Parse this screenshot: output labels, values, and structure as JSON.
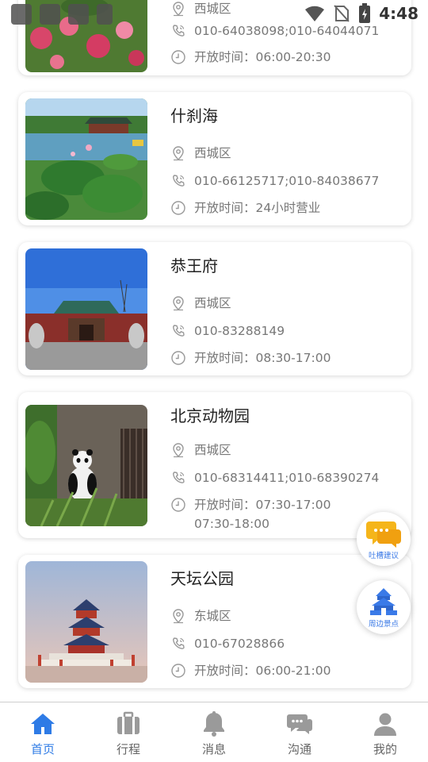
{
  "status_bar": {
    "time": "4:48"
  },
  "attractions": [
    {
      "name": "",
      "district": "西城区",
      "phone": "010-64038098;010-64044071",
      "hours": "开放时间：06:00-20:30"
    },
    {
      "name": "什刹海",
      "district": "西城区",
      "phone": "010-66125717;010-84038677",
      "hours": "开放时间：24小时营业"
    },
    {
      "name": "恭王府",
      "district": "西城区",
      "phone": "010-83288149",
      "hours": "开放时间：08:30-17:00"
    },
    {
      "name": "北京动物园",
      "district": "西城区",
      "phone": "010-68314411;010-68390274",
      "hours": "开放时间：07:30-17:00 07:30-18:00"
    },
    {
      "name": "天坛公园",
      "district": "东城区",
      "phone": "010-67028866",
      "hours": "开放时间：06:00-21:00"
    }
  ],
  "floating": {
    "feedback_label": "吐槽建议",
    "nearby_label": "周边景点"
  },
  "tabs": [
    {
      "label": "首页",
      "icon": "home-icon",
      "active": true
    },
    {
      "label": "行程",
      "icon": "luggage-icon",
      "active": false
    },
    {
      "label": "消息",
      "icon": "bell-icon",
      "active": false
    },
    {
      "label": "沟通",
      "icon": "chat-icon",
      "active": false
    },
    {
      "label": "我的",
      "icon": "user-icon",
      "active": false
    }
  ],
  "colors": {
    "accent": "#2e7be6",
    "text_secondary": "#777777",
    "icon_gray": "#9a9a9a"
  }
}
